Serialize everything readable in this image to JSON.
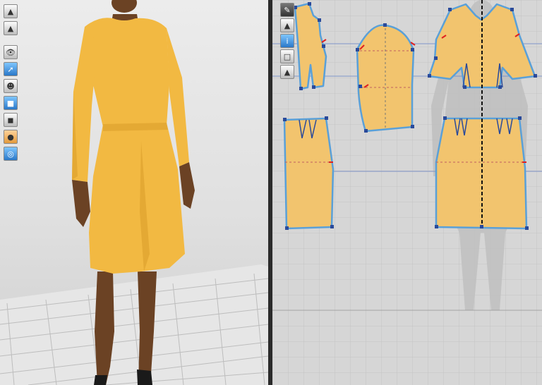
{
  "app": {
    "accent": "#f2b942",
    "pattern_fill": "#f2c46e",
    "outline": "#5aa0d8",
    "point": "#2a4a9a",
    "notch": "#e02020"
  },
  "left_toolbar": {
    "tools": [
      {
        "name": "3d-garment-tool-icon"
      },
      {
        "name": "3d-garment-properties-icon"
      },
      {
        "name": "show-garment-icon"
      },
      {
        "name": "show-avatar-measure-icon"
      },
      {
        "name": "show-avatar-icon"
      },
      {
        "name": "texture-mode-icon"
      },
      {
        "name": "shaded-mode-icon"
      },
      {
        "name": "avatar-skin-icon"
      },
      {
        "name": "environment-globe-icon"
      }
    ]
  },
  "pattern_toolbar": {
    "tools": [
      {
        "name": "pattern-edit-icon"
      },
      {
        "name": "show-3d-garment-icon"
      },
      {
        "name": "info-icon"
      },
      {
        "name": "texture-icon"
      },
      {
        "name": "lock-icon"
      }
    ]
  }
}
